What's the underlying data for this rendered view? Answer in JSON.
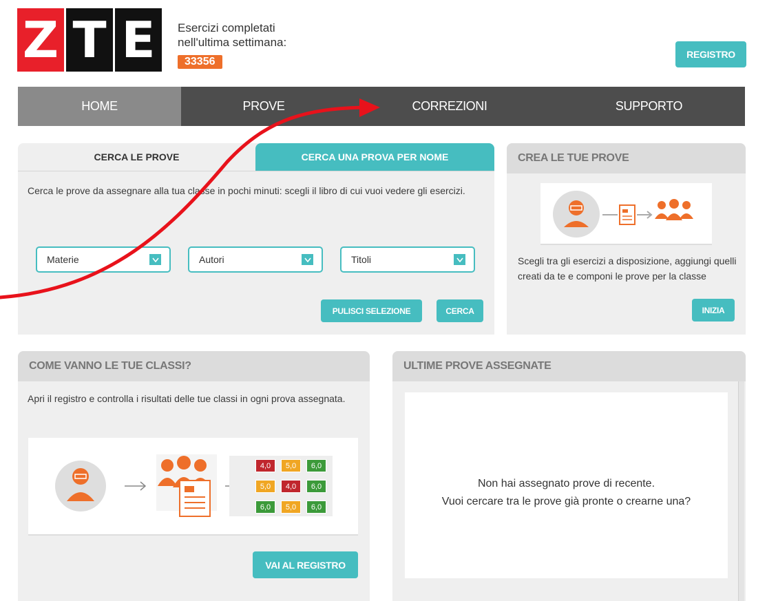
{
  "logo": {
    "letters": [
      "Z",
      "T",
      "E"
    ],
    "colors": [
      "#e8202a",
      "#111111",
      "#111111"
    ]
  },
  "counter": {
    "label": "Esercizi completati nell'ultima settimana:",
    "line1": "Esercizi completati",
    "line2": "nell'ultima settimana:",
    "value": "33356"
  },
  "header": {
    "registro_button": "REGISTRO"
  },
  "nav": {
    "items": [
      "HOME",
      "PROVE",
      "CORREZIONI",
      "SUPPORTO"
    ],
    "active": "HOME"
  },
  "search_panel": {
    "tabs": [
      "CERCA LE PROVE",
      "CERCA UNA PROVA PER NOME"
    ],
    "active_tab": "CERCA LE PROVE",
    "description": "Cerca le prove da assegnare alla tua classe in pochi minuti: scegli il libro di cui vuoi vedere gli esercizi.",
    "selects": [
      "Materie",
      "Autori",
      "Titoli"
    ],
    "clear_button": "PULISCI SELEZIONE",
    "search_button": "CERCA"
  },
  "create_panel": {
    "title": "CREA LE TUE PROVE",
    "description": "Scegli tra gli esercizi a disposizione, aggiungi quelli creati da te e componi le prove per la classe",
    "start_button": "INIZIA"
  },
  "classes_panel": {
    "title": "COME VANNO LE TUE CLASSI?",
    "description": "Apri il registro e controlla i risultati delle tue classi in ogni prova assegnata.",
    "grades": [
      "4,0",
      "5,0",
      "6,0",
      "5,0",
      "4,0",
      "6,0",
      "6,0",
      "5,0",
      "6,0"
    ],
    "grade_colors": [
      "#c0262d",
      "#f0a623",
      "#3c9a3a",
      "#f0a623",
      "#c0262d",
      "#3c9a3a",
      "#3c9a3a",
      "#f0a623",
      "#3c9a3a"
    ],
    "registro_button": "VAI AL REGISTRO"
  },
  "recent_panel": {
    "title": "ULTIME PROVE ASSEGNATE",
    "empty_line1": "Non hai assegnato prove di recente.",
    "empty_line2": "Vuoi cercare tra le prove già pronte o crearne una?"
  },
  "colors": {
    "accent": "#46bdc0",
    "orange": "#ee6f2a",
    "nav": "#4d4d4d",
    "annotation_arrow": "#e8121b"
  }
}
